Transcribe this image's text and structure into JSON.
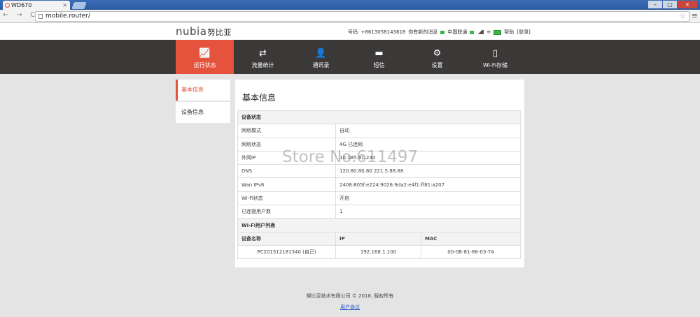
{
  "browser": {
    "tab_title": "WD670",
    "url": "mobile.router/",
    "nav_icons": "← → C"
  },
  "header": {
    "logo_main": "nubia",
    "logo_cn": "努比亚",
    "phone_label": "号码: +8613058143818",
    "msg_label": "你有新的消息",
    "carrier": "中国联通",
    "help": "帮助",
    "login": "[登录]"
  },
  "nav": [
    {
      "label": "运行状态",
      "icon": "chart-icon"
    },
    {
      "label": "流量统计",
      "icon": "transfer-icon"
    },
    {
      "label": "通讯录",
      "icon": "contact-icon"
    },
    {
      "label": "短信",
      "icon": "message-icon"
    },
    {
      "label": "设置",
      "icon": "gear-icon"
    },
    {
      "label": "Wi-Fi存储",
      "icon": "storage-icon"
    }
  ],
  "sidebar": [
    {
      "label": "基本信息"
    },
    {
      "label": "设备信息"
    }
  ],
  "main": {
    "title": "基本信息",
    "section_device": "设备状态",
    "rows": [
      {
        "k": "网络模式",
        "v": "自动"
      },
      {
        "k": "网络状态",
        "v": "4G 已连网"
      },
      {
        "k": "外网IP",
        "v": "10.185.91.234"
      },
      {
        "k": "DNS",
        "v": "120.80.80.80  221.5.88.88"
      },
      {
        "k": "Wan IPv6",
        "v": "2408:805f:e224:9026:9da2:e4f1:ff81:a207"
      },
      {
        "k": "Wi-Fi状态",
        "v": "开启"
      },
      {
        "k": "已连接用户数",
        "v": "1"
      }
    ],
    "section_wifi": "Wi-Fi用户列表",
    "wifi_cols": [
      "设备名称",
      "IP",
      "MAC"
    ],
    "wifi_rows": [
      {
        "name": "PC201512181340 (自己)",
        "ip": "192.168.1.100",
        "mac": "00-0B-81-86-03-74"
      }
    ]
  },
  "watermark": "Store No.611497",
  "footer": {
    "copyright": "努比亚技术有限公司 © 2018. 版权所有",
    "agreement": "用户协议"
  }
}
